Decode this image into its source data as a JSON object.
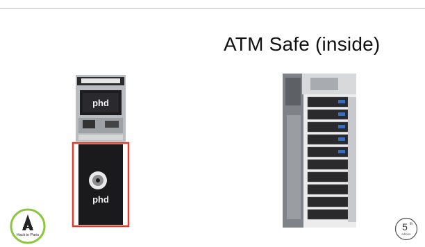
{
  "slide": {
    "title": "ATM Safe (inside)"
  },
  "atm": {
    "brand_top": "phd",
    "brand_bottom": "phd",
    "highlight_color": "#e53a2a"
  },
  "logo": {
    "text": "Hack in Paris",
    "ring_color": "#8cc63f"
  },
  "edition": {
    "number": "5",
    "suffix": "th",
    "word": "edition"
  }
}
